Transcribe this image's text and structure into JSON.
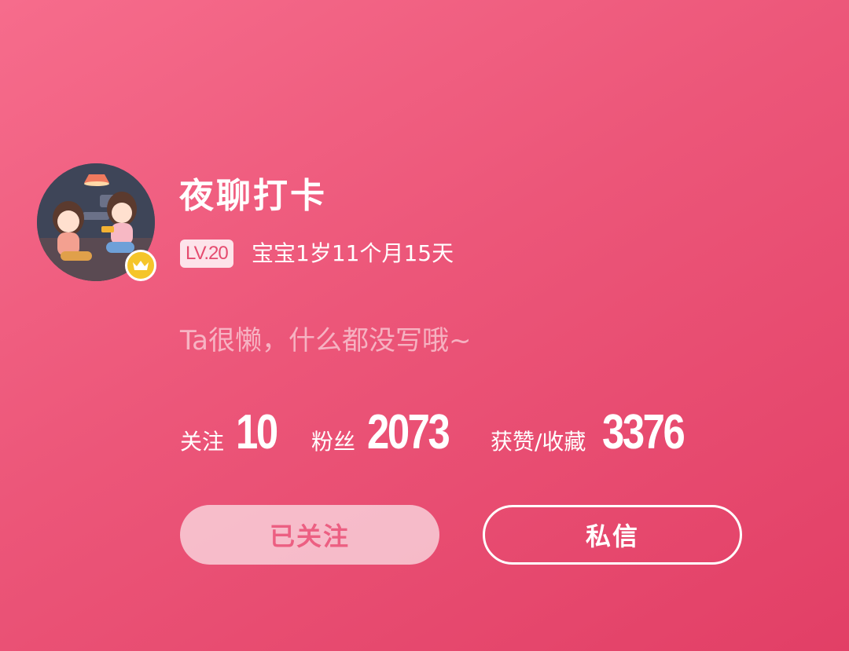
{
  "profile": {
    "name": "夜聊打卡",
    "level": "LV.20",
    "baby_age": "宝宝1岁11个月15天",
    "bio": "Ta很懒，什么都没写哦~",
    "avatar_icon": "couple-illustration-avatar",
    "badge_icon": "crown-icon"
  },
  "stats": {
    "following_label": "关注",
    "following_value": "10",
    "fans_label": "粉丝",
    "fans_value": "2073",
    "likes_label": "获赞/收藏",
    "likes_value": "3376"
  },
  "actions": {
    "followed_label": "已关注",
    "message_label": "私信"
  },
  "colors": {
    "background_start": "#f66c8c",
    "background_end": "#e23f66",
    "badge_gold": "#f5c52a"
  }
}
